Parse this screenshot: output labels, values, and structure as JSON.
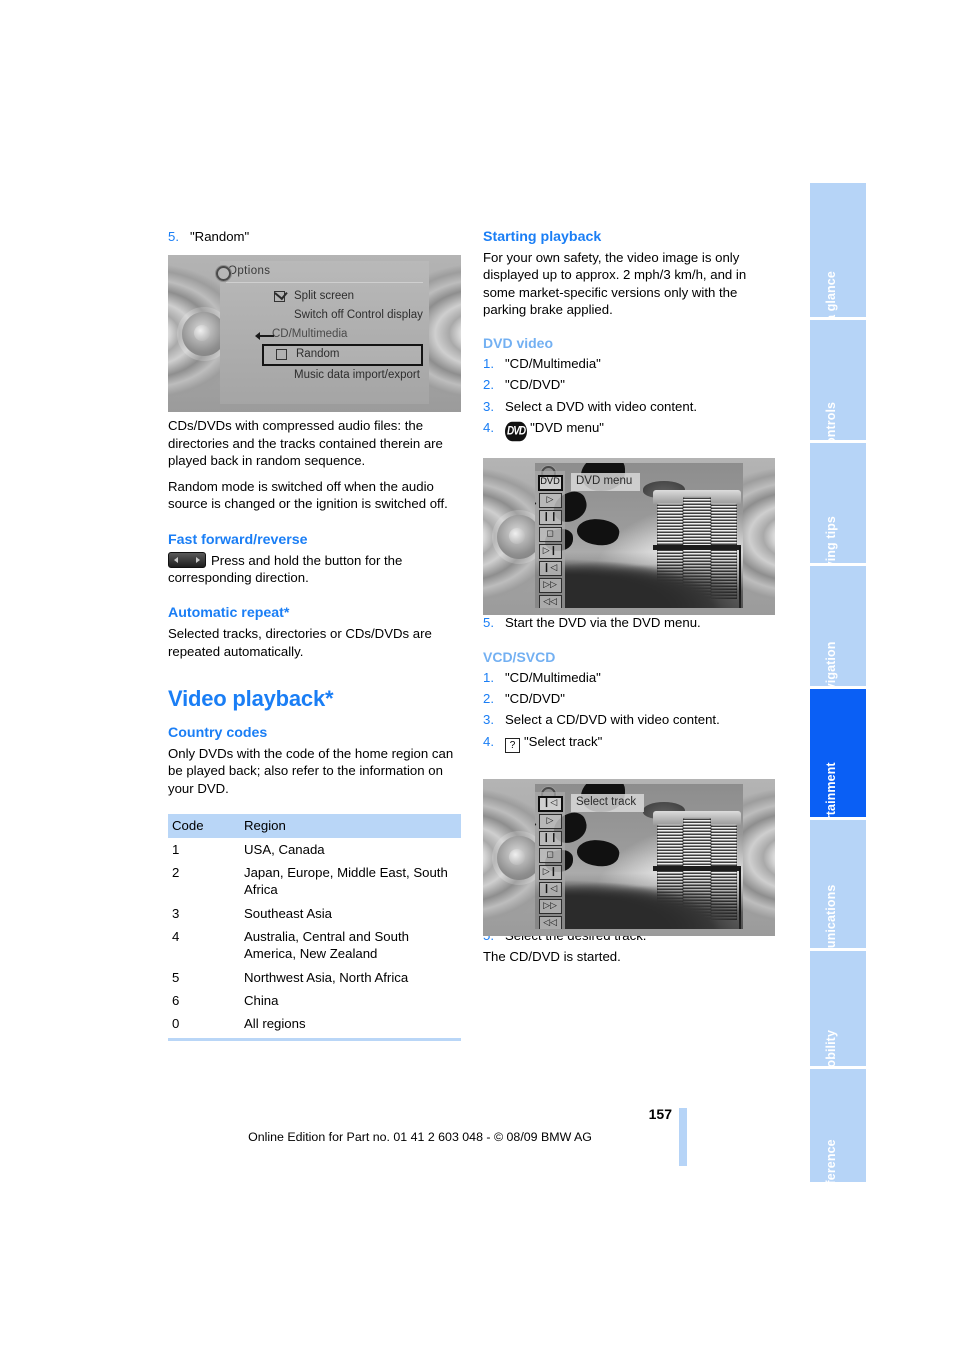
{
  "document": {
    "page_number": "157",
    "footer": "Online Edition for Part no. 01 41 2 603 048 - © 08/09 BMW AG"
  },
  "sidebar": {
    "tabs": [
      {
        "label": "At a glance",
        "active": false
      },
      {
        "label": "Controls",
        "active": false
      },
      {
        "label": "Driving tips",
        "active": false
      },
      {
        "label": "Navigation",
        "active": false
      },
      {
        "label": "Entertainment",
        "active": true
      },
      {
        "label": "Communications",
        "active": false
      },
      {
        "label": "Mobility",
        "active": false
      },
      {
        "label": "Reference",
        "active": false
      }
    ]
  },
  "left_column": {
    "step5_random": {
      "num": "5.",
      "text": "\"Random\""
    },
    "screenshot_options": {
      "title": "Options",
      "rows": [
        {
          "label": "Split screen",
          "checkbox": "checked",
          "group": false,
          "selected": false
        },
        {
          "label": "Switch off Control display",
          "checkbox": "none",
          "group": false,
          "selected": false
        },
        {
          "label": "CD/Multimedia",
          "checkbox": "none",
          "group": true,
          "selected": false
        },
        {
          "label": "Random",
          "checkbox": "unchecked",
          "group": false,
          "selected": true
        },
        {
          "label": "Music data import/export",
          "checkbox": "none",
          "group": false,
          "selected": false
        }
      ]
    },
    "paragraph_1": "CDs/DVDs with compressed audio files: the directories and the tracks contained therein are played back in random sequence.",
    "paragraph_2": "Random mode is switched off when the audio source is changed or the ignition is switched off.",
    "fast_forward": {
      "heading": "Fast forward/reverse",
      "icon": "ff-rew-button-icon",
      "text": "Press and hold the button for the corresponding direction."
    },
    "automatic_repeat": {
      "heading": "Automatic repeat*",
      "text": "Selected tracks, directories or CDs/DVDs are repeated automatically."
    },
    "video_playback": {
      "heading": "Video playback*",
      "country_codes": {
        "heading": "Country codes",
        "intro": "Only DVDs with the code of the home region can be played back; also refer to the information on your DVD.",
        "columns": [
          "Code",
          "Region"
        ],
        "rows": [
          {
            "code": "1",
            "region": "USA, Canada"
          },
          {
            "code": "2",
            "region": "Japan, Europe, Middle East, South Africa"
          },
          {
            "code": "3",
            "region": "Southeast Asia"
          },
          {
            "code": "4",
            "region": "Australia, Central and South America, New Zealand"
          },
          {
            "code": "5",
            "region": "Northwest Asia, North Africa"
          },
          {
            "code": "6",
            "region": "China"
          },
          {
            "code": "0",
            "region": "All regions"
          }
        ]
      }
    }
  },
  "right_column": {
    "starting_playback": {
      "heading": "Starting playback",
      "text": "For your own safety, the video image is only displayed up to approx. 2 mph/3 km/h, and in some market-specific versions only with the parking brake applied."
    },
    "dvd_video": {
      "heading": "DVD video",
      "steps": [
        {
          "num": "1.",
          "text": "\"CD/Multimedia\"",
          "icon": null
        },
        {
          "num": "2.",
          "text": "\"CD/DVD\"",
          "icon": null
        },
        {
          "num": "3.",
          "text": "Select a DVD with video content.",
          "icon": null
        },
        {
          "num": "4.",
          "text": "\"DVD menu\"",
          "icon": "dvd-logo-icon"
        }
      ],
      "step5": {
        "num": "5.",
        "text": "Start the DVD via the DVD menu."
      },
      "screenshot_label": "DVD menu"
    },
    "vcd_svcd": {
      "heading": "VCD/SVCD",
      "steps": [
        {
          "num": "1.",
          "text": "\"CD/Multimedia\"",
          "icon": null
        },
        {
          "num": "2.",
          "text": "\"CD/DVD\"",
          "icon": null
        },
        {
          "num": "3.",
          "text": "Select a CD/DVD with video content.",
          "icon": null
        },
        {
          "num": "4.",
          "text": "\"Select track\"",
          "icon": "question-mark-icon"
        }
      ],
      "step5": {
        "num": "5.",
        "text": "Select the desired track."
      },
      "closing": "The CD/DVD is started.",
      "screenshot_label": "Select track"
    },
    "video_toolbar_icons": [
      "dvd-menu-icon",
      "play-icon",
      "pause-icon",
      "stop-icon",
      "next-track-icon",
      "previous-track-icon",
      "fast-forward-icon",
      "rewind-icon"
    ]
  },
  "colors": {
    "accent_blue": "#1a7ef5",
    "light_blue": "#73b0f2",
    "tab_blue": "#b6d4f7",
    "tab_active_blue": "#0a5ff5",
    "table_header": "#b9d6f7"
  }
}
